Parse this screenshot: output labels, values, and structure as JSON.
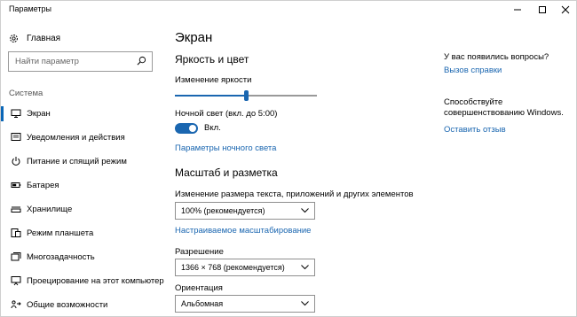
{
  "window": {
    "title": "Параметры"
  },
  "sidebar": {
    "home_label": "Главная",
    "search_placeholder": "Найти параметр",
    "section_label": "Система",
    "items": [
      {
        "label": "Экран",
        "icon": "monitor-icon",
        "active": true
      },
      {
        "label": "Уведомления и действия",
        "icon": "notifications-icon"
      },
      {
        "label": "Питание и спящий режим",
        "icon": "power-icon"
      },
      {
        "label": "Батарея",
        "icon": "battery-icon"
      },
      {
        "label": "Хранилище",
        "icon": "storage-icon"
      },
      {
        "label": "Режим планшета",
        "icon": "tablet-mode-icon"
      },
      {
        "label": "Многозадачность",
        "icon": "multitasking-icon"
      },
      {
        "label": "Проецирование на этот компьютер",
        "icon": "projecting-icon"
      },
      {
        "label": "Общие возможности",
        "icon": "shared-experiences-icon"
      }
    ]
  },
  "main": {
    "title": "Экран",
    "brightness": {
      "heading": "Яркость и цвет",
      "slider_label": "Изменение яркости",
      "slider_value": 50,
      "night_light_label": "Ночной свет (вкл. до 5:00)",
      "toggle_state": "Вкл.",
      "toggle_on": true,
      "night_light_link": "Параметры ночного света"
    },
    "scale": {
      "heading": "Масштаб и разметка",
      "size_label": "Изменение размера текста, приложений и других элементов",
      "size_value": "100% (рекомендуется)",
      "custom_scale_link": "Настраиваемое масштабирование",
      "resolution_label": "Разрешение",
      "resolution_value": "1366 × 768 (рекомендуется)",
      "orientation_label": "Ориентация",
      "orientation_value": "Альбомная"
    }
  },
  "aside": {
    "question": "У вас появились вопросы?",
    "help_link": "Вызов справки",
    "feedback_text": "Способствуйте совершенствованию Windows.",
    "feedback_link": "Оставить отзыв"
  },
  "colors": {
    "accent": "#1a66b0",
    "active_marker": "#0a66b7"
  }
}
